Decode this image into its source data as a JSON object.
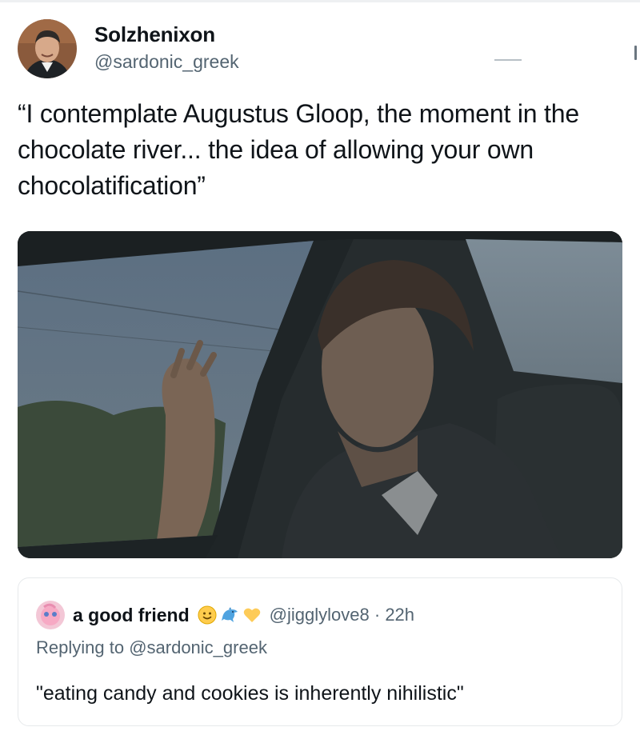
{
  "tweet": {
    "display_name": "Solzhenixon",
    "handle": "@sardonic_greek",
    "text": "“I contemplate Augustus Gloop, the moment in the chocolate river... the idea of allowing your own chocolatification”",
    "media": {
      "icon": "photo-icon"
    }
  },
  "reply": {
    "display_name": "a good friend",
    "emojis": [
      "slightly-smiling-face-icon",
      "dolphin-icon",
      "yellow-heart-icon"
    ],
    "handle": "@jigglylove8",
    "separator": "·",
    "time": "22h",
    "replying_prefix": "Replying to ",
    "replying_to": "@sardonic_greek",
    "text": "\"eating candy and cookies is inherently nihilistic\""
  },
  "colors": {
    "text_primary": "#0f1419",
    "text_secondary": "#536471",
    "card_border": "#e6e9eb"
  }
}
